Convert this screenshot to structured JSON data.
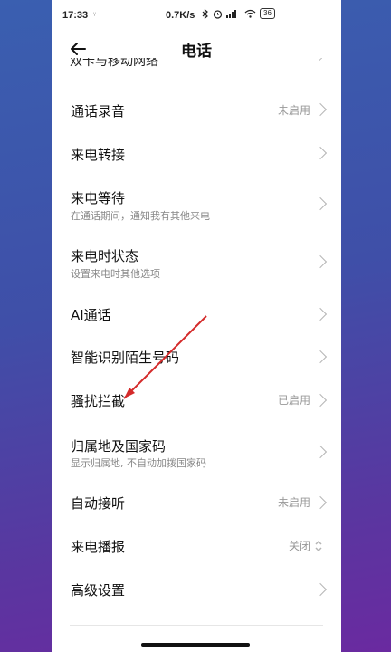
{
  "status_bar": {
    "time": "17:33",
    "time_suffix": "ᵞ",
    "network_speed": "0.7K/s",
    "battery": "36"
  },
  "header": {
    "title": "电话"
  },
  "partial_item": {
    "label": "双卡与移动网络"
  },
  "settings": [
    {
      "label": "通话录音",
      "value": "未启用"
    },
    {
      "label": "来电转接",
      "value": ""
    },
    {
      "label": "来电等待",
      "sub": "在通话期间，通知我有其他来电"
    },
    {
      "label": "来电时状态",
      "sub": "设置来电时其他选项"
    },
    {
      "label": "AI通话",
      "value": ""
    },
    {
      "label": "智能识别陌生号码",
      "value": ""
    },
    {
      "label": "骚扰拦截",
      "value": "已启用"
    },
    {
      "label": "归属地及国家码",
      "sub": "显示归属地, 不自动加拨国家码"
    },
    {
      "label": "自动接听",
      "value": "未启用"
    },
    {
      "label": "来电播报",
      "value": "关闭"
    },
    {
      "label": "高级设置",
      "value": ""
    }
  ],
  "colors": {
    "annotation_arrow": "#d42a2a",
    "background_gradient_top": "#3a5fb0",
    "background_gradient_bottom": "#6a2aa0"
  }
}
